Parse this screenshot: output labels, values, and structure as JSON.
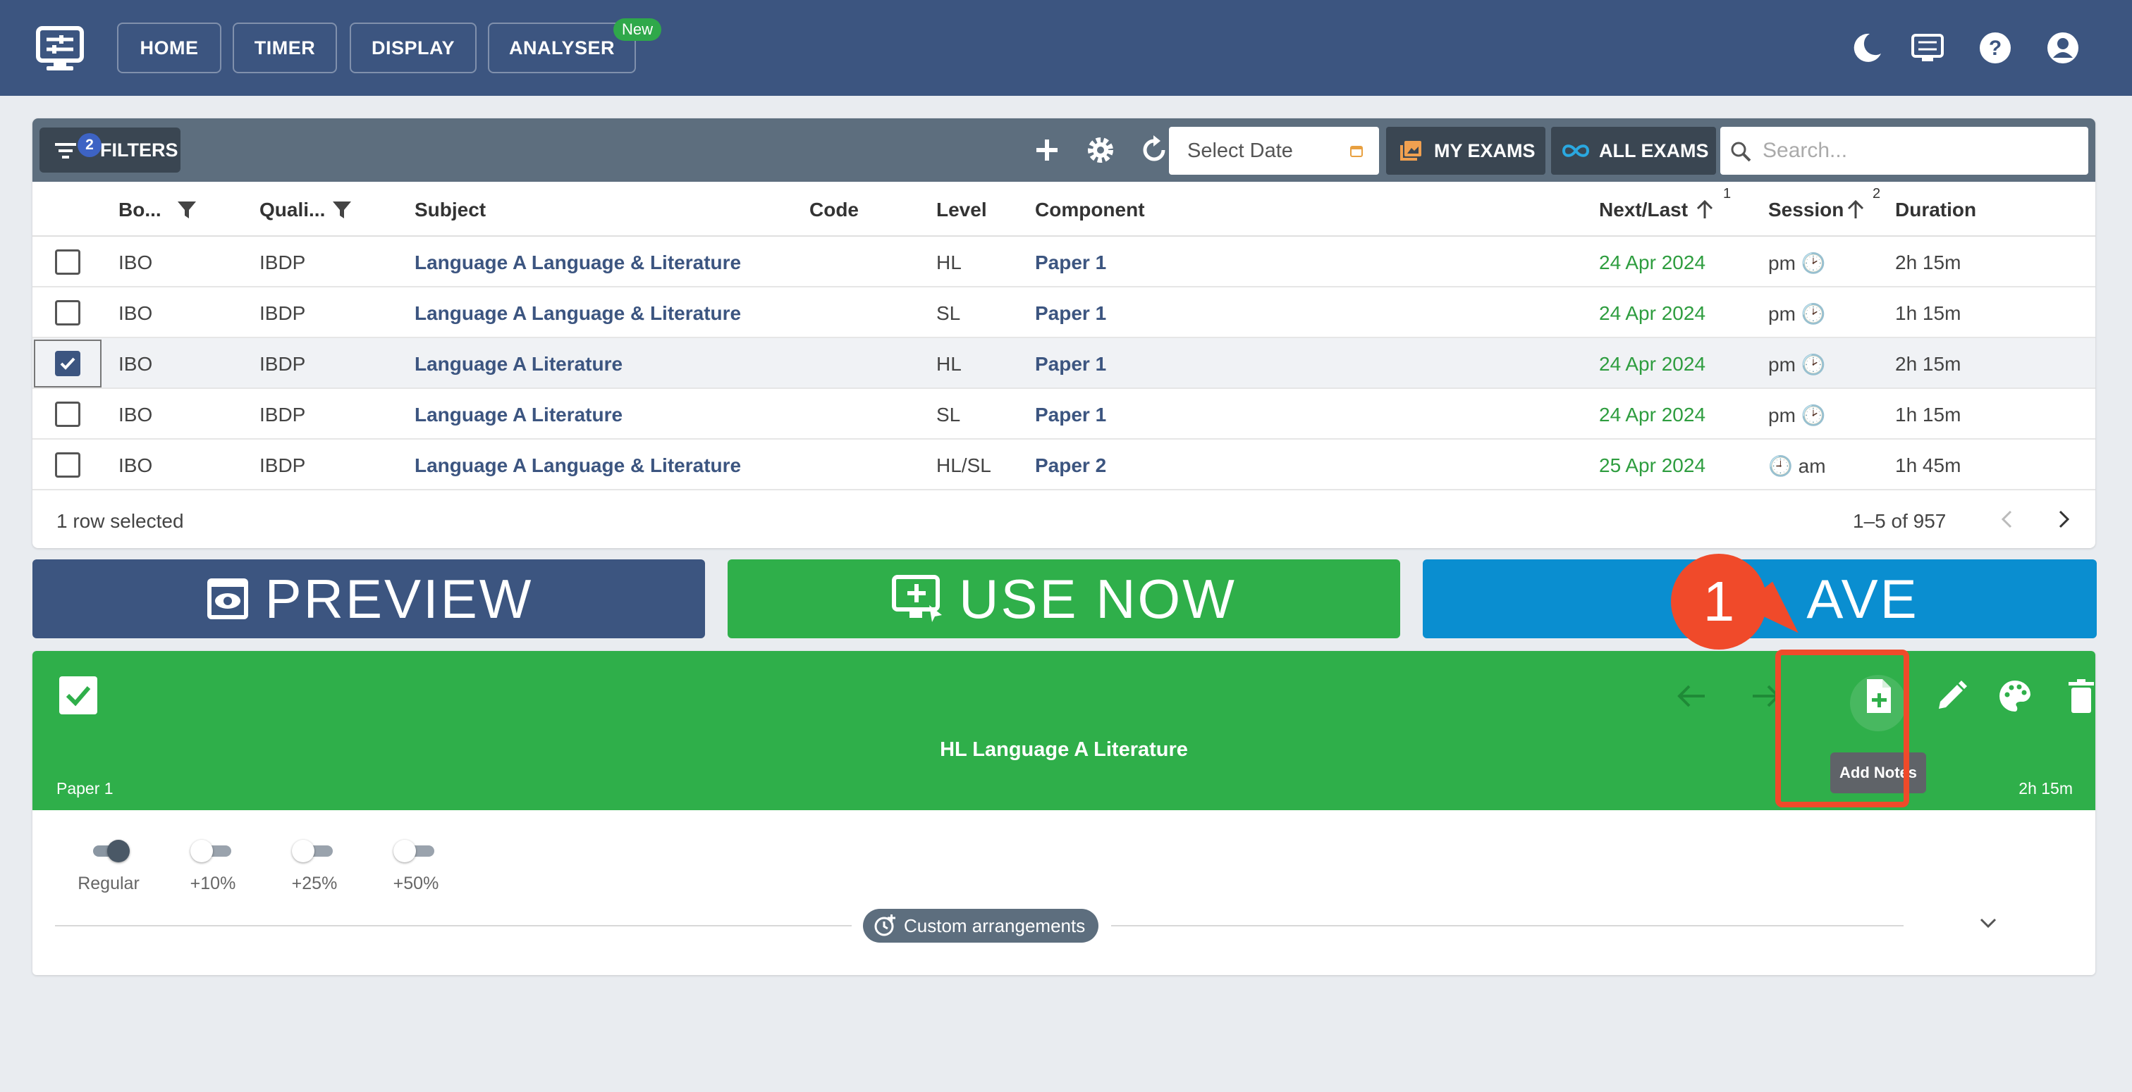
{
  "header": {
    "nav": [
      {
        "label": "HOME"
      },
      {
        "label": "TIMER"
      },
      {
        "label": "DISPLAY"
      },
      {
        "label": "ANALYSER"
      }
    ],
    "new_badge": "New",
    "icons": [
      "moon-icon",
      "display-settings-icon",
      "help-icon",
      "account-icon"
    ]
  },
  "toolbar": {
    "filters_label": "FILTERS",
    "filters_count": "2",
    "date_placeholder": "Select Date",
    "my_exams": "MY EXAMS",
    "all_exams": "ALL EXAMS",
    "search_placeholder": "Search..."
  },
  "table": {
    "columns": [
      "Bo...",
      "Quali...",
      "Subject",
      "Code",
      "Level",
      "Component",
      "Next/Last",
      "Session",
      "Duration"
    ],
    "sort_order": [
      "1",
      "2"
    ],
    "rows": [
      {
        "board": "IBO",
        "qual": "IBDP",
        "subject": "Language A Language & Literature",
        "code": "",
        "level": "HL",
        "component": "Paper 1",
        "date": "24 Apr 2024",
        "session": "pm 🕑",
        "duration": "2h 15m",
        "selected": false
      },
      {
        "board": "IBO",
        "qual": "IBDP",
        "subject": "Language A Language & Literature",
        "code": "",
        "level": "SL",
        "component": "Paper 1",
        "date": "24 Apr 2024",
        "session": "pm 🕑",
        "duration": "1h 15m",
        "selected": false
      },
      {
        "board": "IBO",
        "qual": "IBDP",
        "subject": "Language A Literature",
        "code": "",
        "level": "HL",
        "component": "Paper 1",
        "date": "24 Apr 2024",
        "session": "pm 🕑",
        "duration": "2h 15m",
        "selected": true
      },
      {
        "board": "IBO",
        "qual": "IBDP",
        "subject": "Language A Literature",
        "code": "",
        "level": "SL",
        "component": "Paper 1",
        "date": "24 Apr 2024",
        "session": "pm 🕑",
        "duration": "1h 15m",
        "selected": false
      },
      {
        "board": "IBO",
        "qual": "IBDP",
        "subject": "Language A Language & Literature",
        "code": "",
        "level": "HL/SL",
        "component": "Paper 2",
        "date": "25 Apr 2024",
        "session": "🕘 am",
        "duration": "1h 45m",
        "selected": false
      }
    ],
    "footer_selected": "1 row selected",
    "pagination": "1–5 of 957"
  },
  "actions": {
    "preview": "PREVIEW",
    "use_now": "USE NOW",
    "save": "AVE"
  },
  "exam_panel": {
    "title": "HL Language A Literature",
    "component": "Paper 1",
    "duration": "2h 15m",
    "tooltip": "Add Notes",
    "extra_time": [
      {
        "label": "Regular",
        "on": true
      },
      {
        "label": "+10%",
        "on": false
      },
      {
        "label": "+25%",
        "on": false
      },
      {
        "label": "+50%",
        "on": false
      }
    ],
    "custom_arrangements": "Custom arrangements"
  },
  "annotation": {
    "number": "1"
  },
  "colors": {
    "header": "#3c5580",
    "toolbar": "#5d6e7e",
    "use_now": "#2faf4a",
    "save": "#0a8ed0",
    "date_green": "#2e9d3f",
    "annotation": "#f04a2a"
  }
}
